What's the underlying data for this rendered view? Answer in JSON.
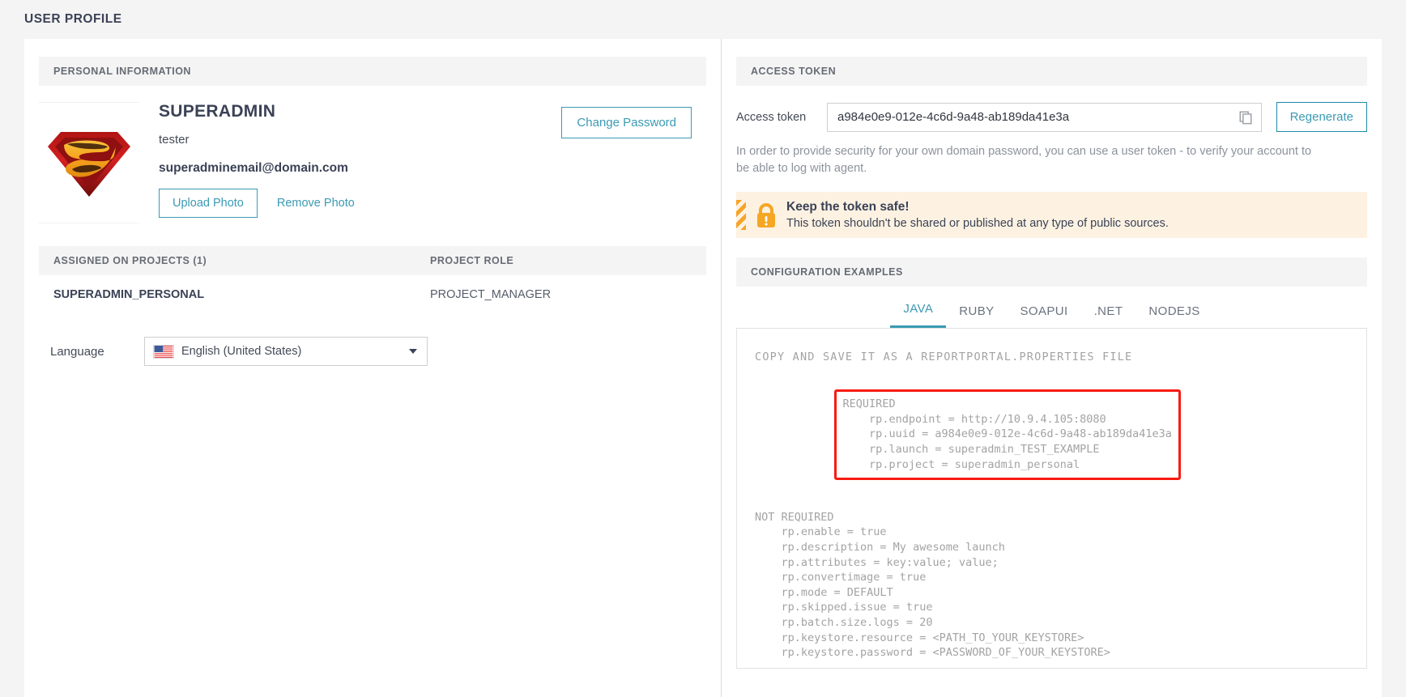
{
  "header": {
    "title": "USER PROFILE"
  },
  "personal": {
    "section_title": "PERSONAL INFORMATION",
    "avatar_icon": "superman-shield-logo",
    "name": "SUPERADMIN",
    "role": "tester",
    "email": "superadminemail@domain.com",
    "upload_photo_label": "Upload Photo",
    "remove_photo_label": "Remove Photo",
    "change_password_label": "Change Password"
  },
  "projects": {
    "col_projects": "ASSIGNED ON PROJECTS (1)",
    "col_role": "PROJECT ROLE",
    "rows": [
      {
        "project": "SUPERADMIN_PERSONAL",
        "role": "PROJECT_MANAGER"
      }
    ]
  },
  "language": {
    "label": "Language",
    "selected": "English (United States)",
    "flag_icon": "flag-us-icon",
    "caret_icon": "chevron-down-icon"
  },
  "access_token": {
    "section_title": "ACCESS TOKEN",
    "field_label": "Access token",
    "value": "a984e0e9-012e-4c6d-9a48-ab189da41e3a",
    "copy_icon": "copy-icon",
    "regenerate_label": "Regenerate",
    "note": "In order to provide security for your own domain password, you can use a user token - to verify your account to be able to log with agent.",
    "warning": {
      "icon": "lock-warning-icon",
      "title": "Keep the token safe!",
      "body": "This token shouldn't be shared or published at any type of public sources."
    }
  },
  "configuration": {
    "section_title": "CONFIGURATION EXAMPLES",
    "tabs": [
      {
        "label": "JAVA",
        "active": true
      },
      {
        "label": "RUBY",
        "active": false
      },
      {
        "label": "SOAPUI",
        "active": false
      },
      {
        "label": ".NET",
        "active": false
      },
      {
        "label": "NODEJS",
        "active": false
      }
    ],
    "code": {
      "title": "COPY AND SAVE IT AS A REPORTPORTAL.PROPERTIES FILE",
      "required_block": "REQUIRED\n    rp.endpoint = http://10.9.4.105:8080\n    rp.uuid = a984e0e9-012e-4c6d-9a48-ab189da41e3a\n    rp.launch = superadmin_TEST_EXAMPLE\n    rp.project = superadmin_personal",
      "not_required_block": "NOT REQUIRED\n    rp.enable = true\n    rp.description = My awesome launch\n    rp.attributes = key:value; value;\n    rp.convertimage = true\n    rp.mode = DEFAULT\n    rp.skipped.issue = true\n    rp.batch.size.logs = 20\n    rp.keystore.resource = <PATH_TO_YOUR_KEYSTORE>\n    rp.keystore.password = <PASSWORD_OF_YOUR_KEYSTORE>"
    }
  },
  "colors": {
    "accent": "#3b9ab3",
    "warning_bg": "#fdf2e2",
    "warning_accent": "#f7a42a",
    "highlight_border": "#f81b12",
    "text_dark": "#3b4256"
  }
}
